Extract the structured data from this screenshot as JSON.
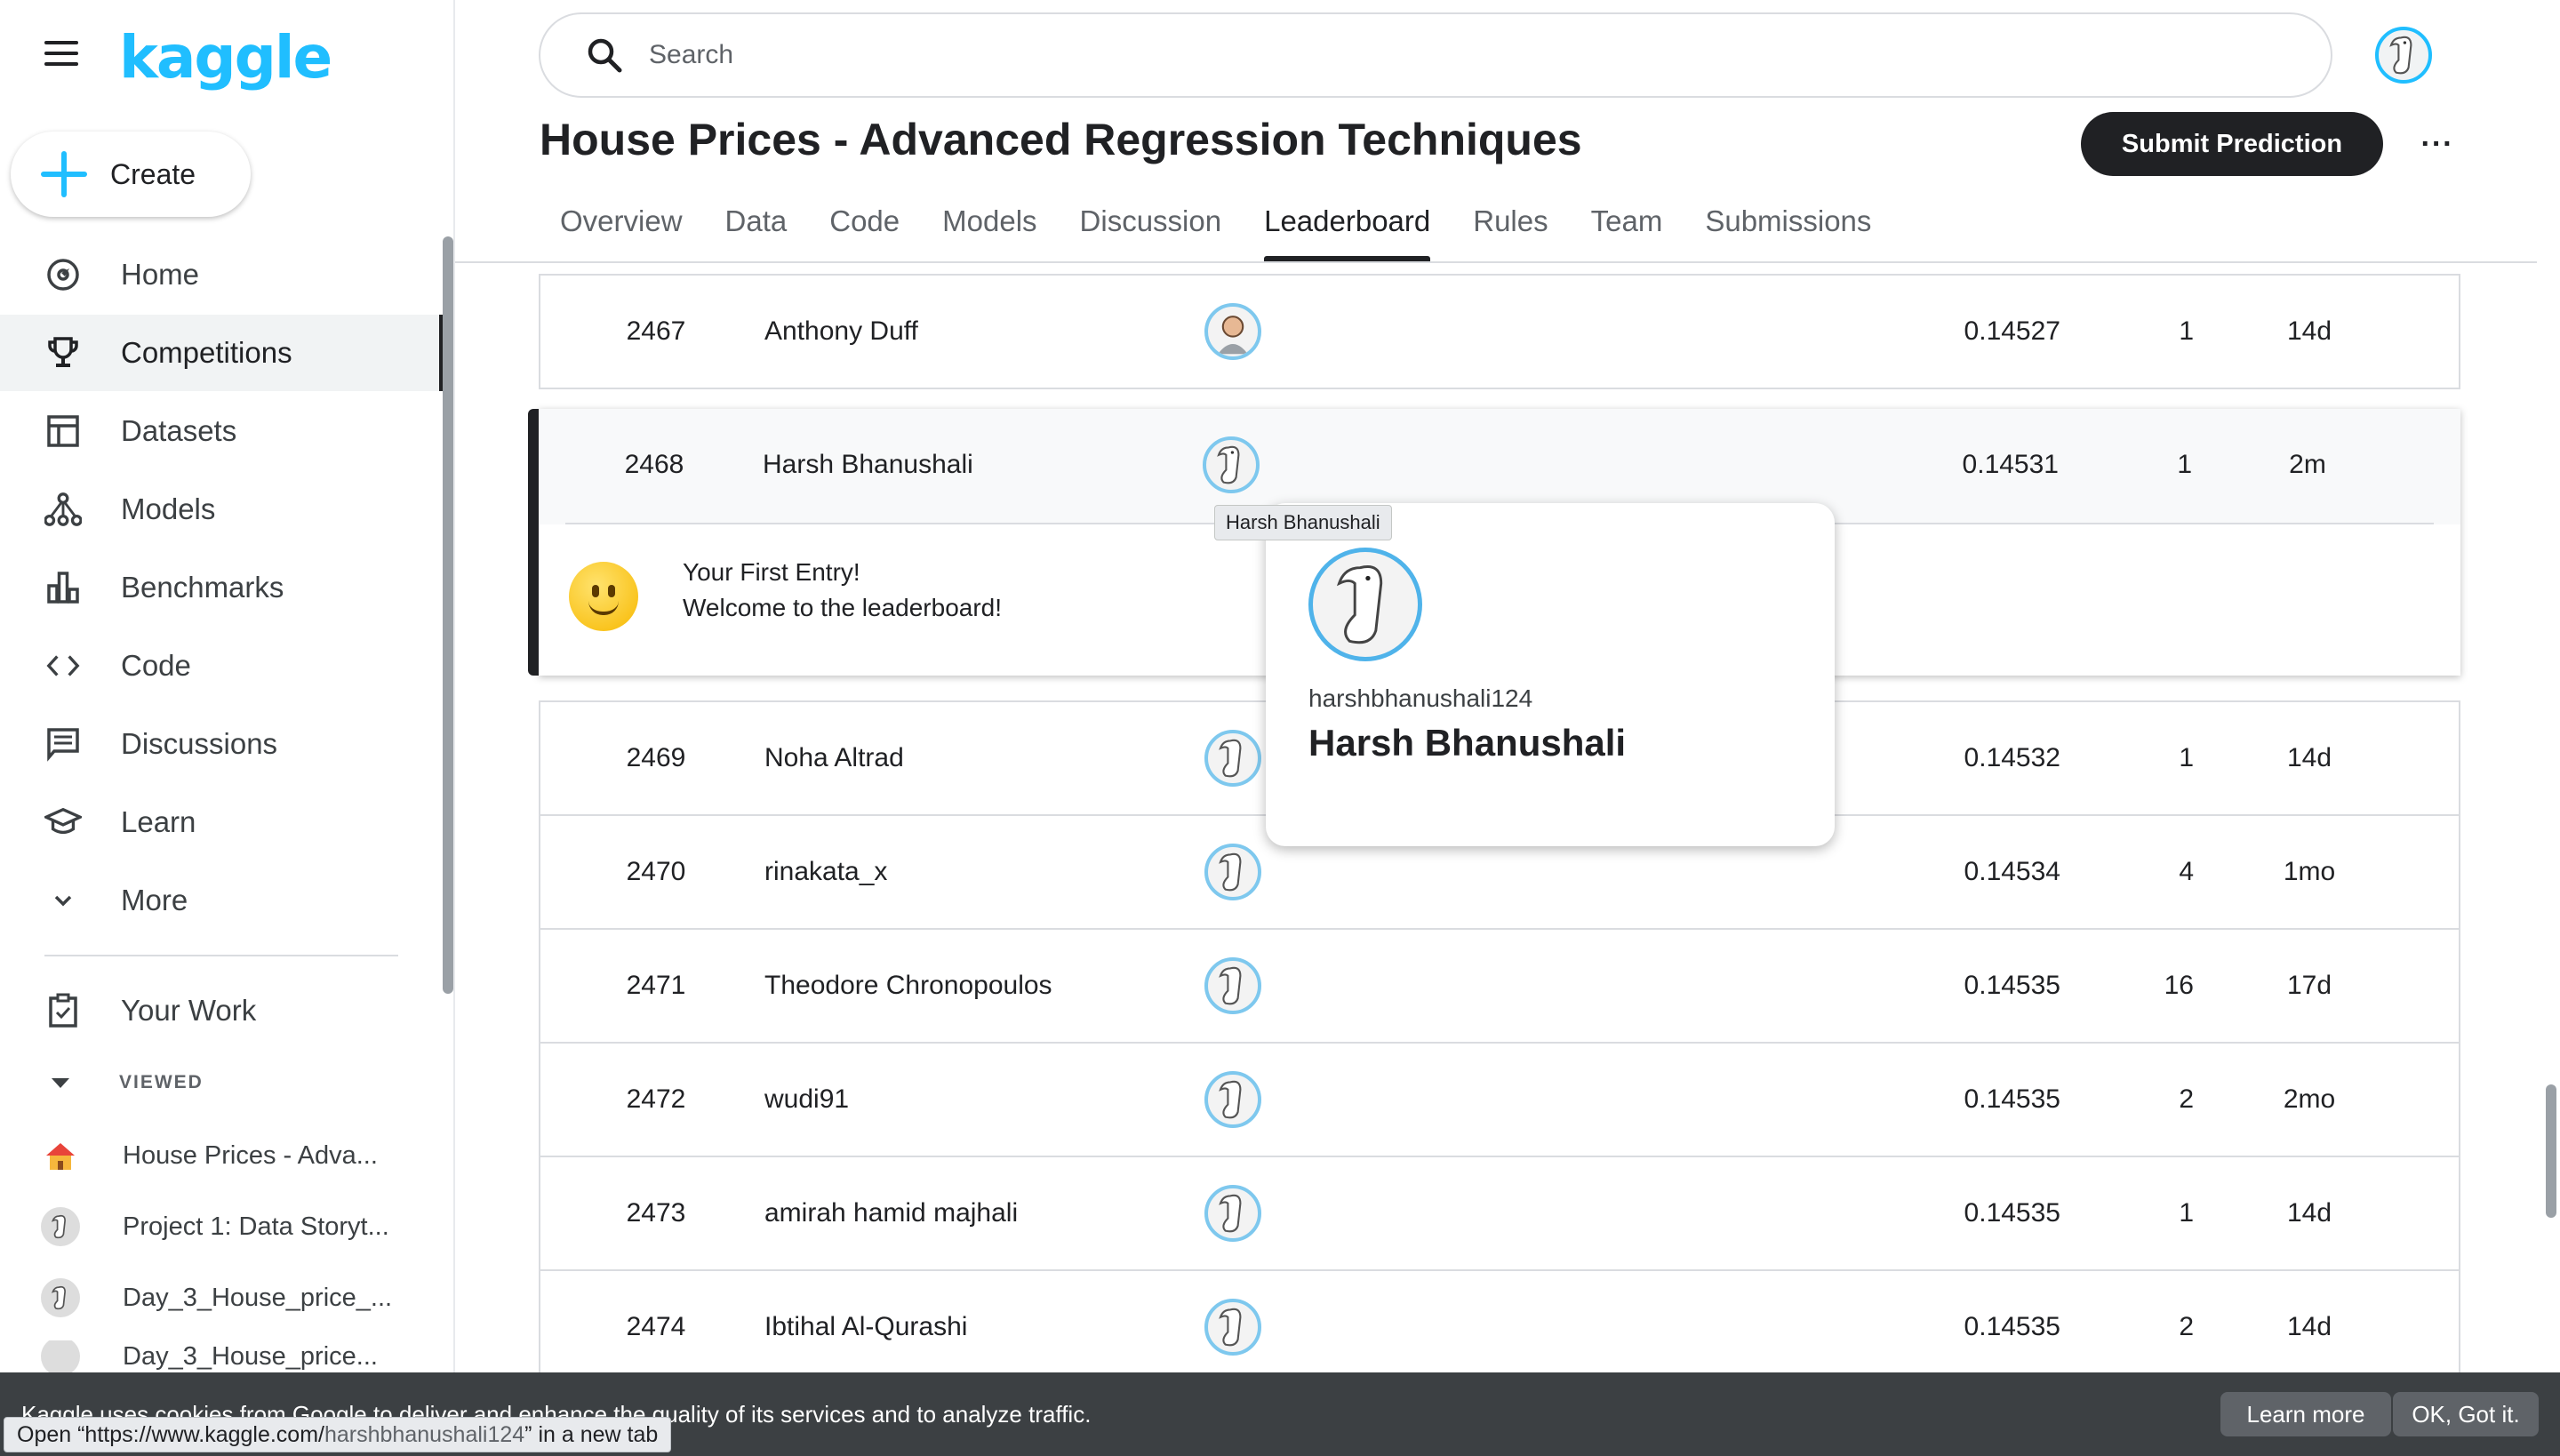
{
  "app": {
    "logo": "kaggle"
  },
  "sidebar": {
    "create_label": "Create",
    "items": [
      {
        "label": "Home",
        "icon": "compass-icon"
      },
      {
        "label": "Competitions",
        "icon": "trophy-icon",
        "active": true
      },
      {
        "label": "Datasets",
        "icon": "table-icon"
      },
      {
        "label": "Models",
        "icon": "models-icon"
      },
      {
        "label": "Benchmarks",
        "icon": "bar-chart-icon"
      },
      {
        "label": "Code",
        "icon": "code-icon"
      },
      {
        "label": "Discussions",
        "icon": "discussion-icon"
      },
      {
        "label": "Learn",
        "icon": "graduation-cap-icon"
      },
      {
        "label": "More",
        "icon": "chevron-down-icon"
      }
    ],
    "your_work_label": "Your Work",
    "viewed_header": "VIEWED",
    "viewed": [
      {
        "label": "House Prices - Adva..."
      },
      {
        "label": "Project 1: Data Storyt..."
      },
      {
        "label": "Day_3_House_price_..."
      },
      {
        "label": "Day_3_House_price..."
      }
    ]
  },
  "header": {
    "search_placeholder": "Search",
    "title": "House Prices - Advanced Regression Techniques",
    "submit_label": "Submit Prediction",
    "more_label": "···",
    "tabs": [
      "Overview",
      "Data",
      "Code",
      "Models",
      "Discussion",
      "Leaderboard",
      "Rules",
      "Team",
      "Submissions"
    ],
    "active_tab": "Leaderboard"
  },
  "leaderboard": {
    "rows_above": [
      {
        "rank": "2467",
        "name": "Anthony Duff",
        "score": "0.14527",
        "entries": "1",
        "last": "14d"
      }
    ],
    "highlight": {
      "rank": "2468",
      "name": "Harsh Bhanushali",
      "score": "0.14531",
      "entries": "1",
      "last": "2m",
      "message_line1": "Your First Entry!",
      "message_line2": "Welcome to the leaderboard!"
    },
    "rows_below": [
      {
        "rank": "2469",
        "name": "Noha Altrad",
        "score": "0.14532",
        "entries": "1",
        "last": "14d"
      },
      {
        "rank": "2470",
        "name": "rinakata_x",
        "score": "0.14534",
        "entries": "4",
        "last": "1mo"
      },
      {
        "rank": "2471",
        "name": "Theodore Chronopoulos",
        "score": "0.14535",
        "entries": "16",
        "last": "17d"
      },
      {
        "rank": "2472",
        "name": "wudi91",
        "score": "0.14535",
        "entries": "2",
        "last": "2mo"
      },
      {
        "rank": "2473",
        "name": "amirah hamid majhali",
        "score": "0.14535",
        "entries": "1",
        "last": "14d"
      },
      {
        "rank": "2474",
        "name": "Ibtihal Al-Qurashi",
        "score": "0.14535",
        "entries": "2",
        "last": "14d"
      }
    ]
  },
  "popover": {
    "tooltip": "Harsh Bhanushali",
    "username": "harshbhanushali124",
    "display_name": "Harsh Bhanushali"
  },
  "cookie": {
    "text": "Kaggle uses cookies from Google to deliver and enhance the quality of its services and to analyze traffic.",
    "learn_more": "Learn more",
    "ok": "OK, Got it."
  },
  "status_bar": {
    "prefix": "Open “https://www.kaggle.com/",
    "path": "harshbhanushali124",
    "suffix": "” in a new tab"
  },
  "colors": {
    "accent": "#20beff",
    "dark": "#202124",
    "cookie_bg": "#3c4043"
  }
}
